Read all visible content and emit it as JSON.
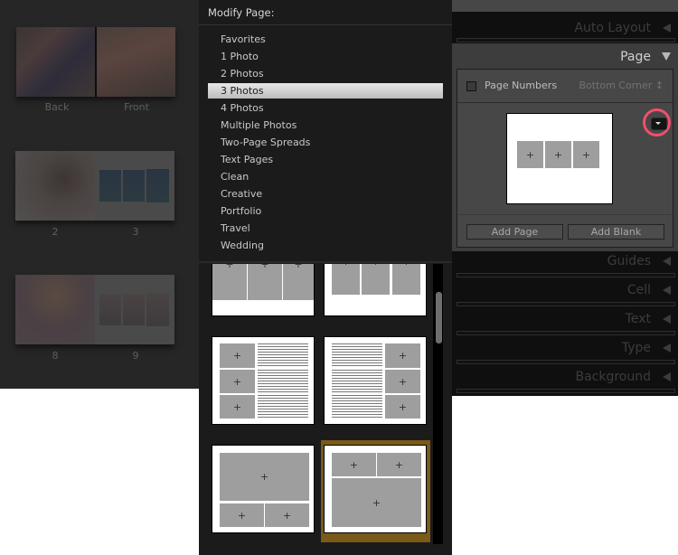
{
  "filmstrip": {
    "spreads": [
      {
        "left_label": "Back",
        "right_label": "Front"
      },
      {
        "left_label": "2",
        "right_label": "3"
      },
      {
        "left_label": "8",
        "right_label": "9"
      }
    ]
  },
  "menu": {
    "title": "Modify Page:",
    "items": [
      {
        "label": "Favorites"
      },
      {
        "label": "1 Photo"
      },
      {
        "label": "2 Photos"
      },
      {
        "label": "3 Photos",
        "selected": true
      },
      {
        "label": "4 Photos"
      },
      {
        "label": "Multiple Photos"
      },
      {
        "label": "Two-Page Spreads"
      },
      {
        "label": "Text Pages"
      },
      {
        "label": "Clean"
      },
      {
        "label": "Creative"
      },
      {
        "label": "Portfolio"
      },
      {
        "label": "Travel"
      },
      {
        "label": "Wedding"
      }
    ],
    "cell_glyph": "+"
  },
  "right_panel": {
    "auto_layout": "Auto Layout",
    "page": {
      "title": "Page",
      "page_numbers_label": "Page Numbers",
      "page_numbers_checked": false,
      "page_numbers_position": "Bottom Corner ↕",
      "add_page": "Add Page",
      "add_blank": "Add Blank"
    },
    "sections": [
      "Guides",
      "Cell",
      "Text",
      "Type",
      "Background"
    ]
  },
  "colors": {
    "highlight_circle": "#f04f6a",
    "selected_template": "#7a5a1a"
  }
}
